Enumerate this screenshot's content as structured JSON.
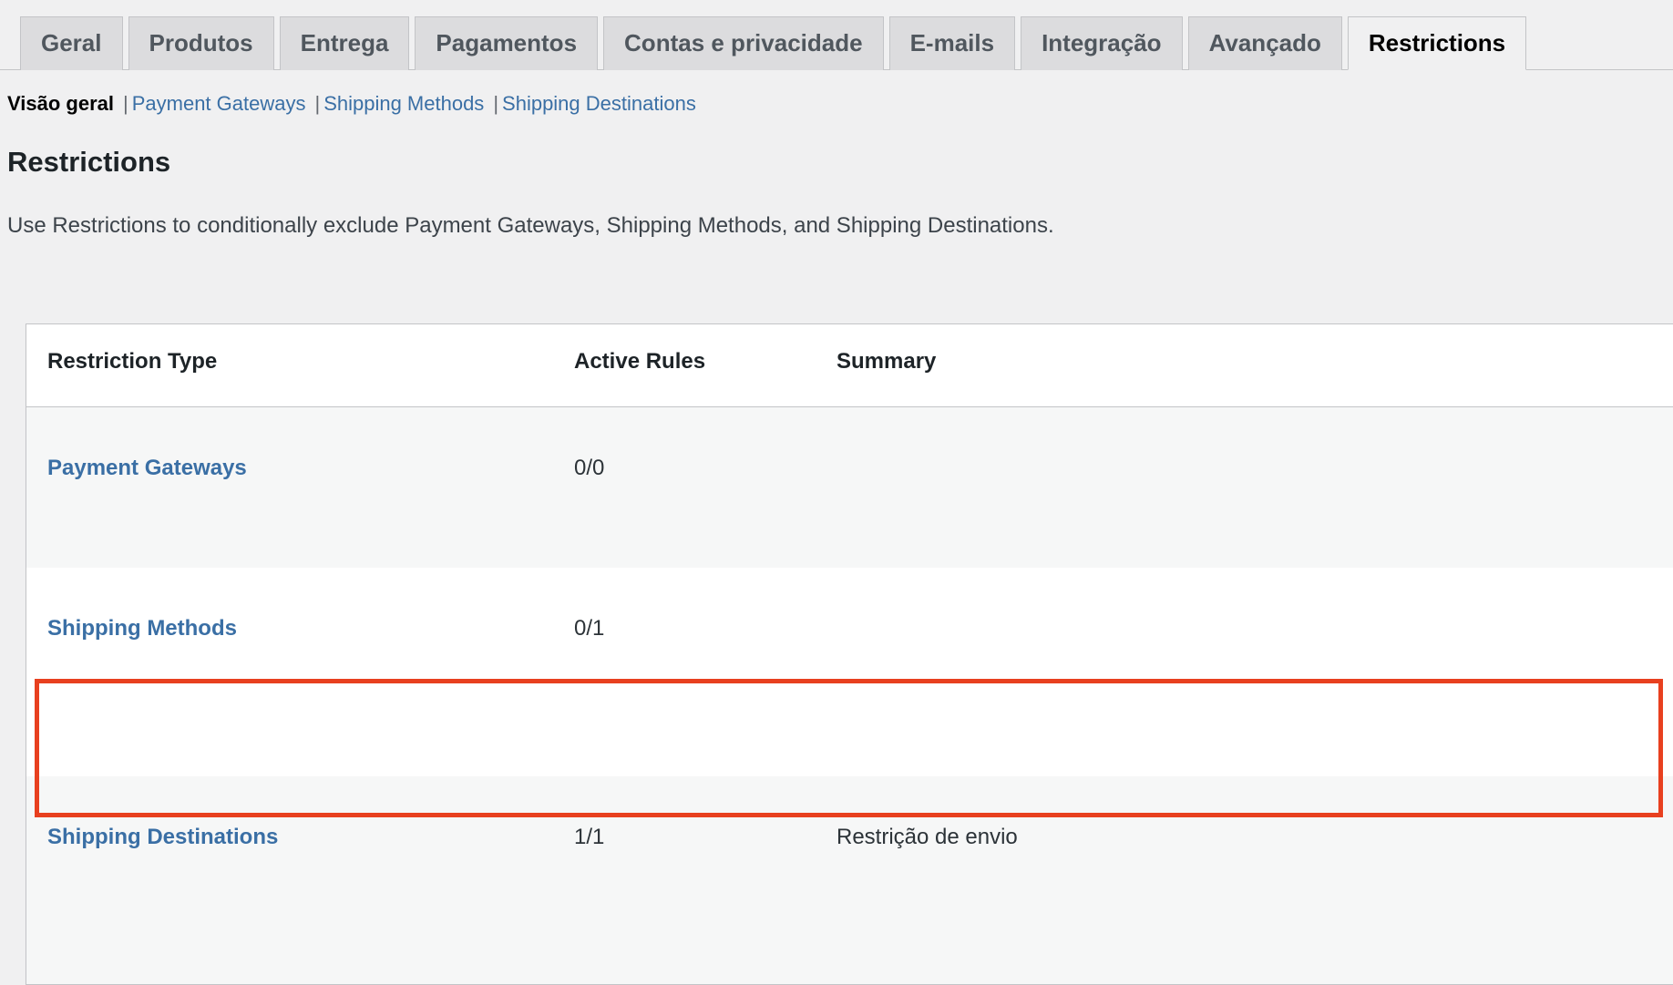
{
  "tabs": [
    {
      "label": "Geral",
      "active": false
    },
    {
      "label": "Produtos",
      "active": false
    },
    {
      "label": "Entrega",
      "active": false
    },
    {
      "label": "Pagamentos",
      "active": false
    },
    {
      "label": "Contas e privacidade",
      "active": false
    },
    {
      "label": "E-mails",
      "active": false
    },
    {
      "label": "Integração",
      "active": false
    },
    {
      "label": "Avançado",
      "active": false
    },
    {
      "label": "Restrictions",
      "active": true
    }
  ],
  "subnav": {
    "current": "Visão geral",
    "separator": "|",
    "links": [
      "Payment Gateways",
      "Shipping Methods",
      "Shipping Destinations"
    ]
  },
  "heading": "Restrictions",
  "description": "Use Restrictions to conditionally exclude Payment Gateways, Shipping Methods, and Shipping Destinations.",
  "table": {
    "columns": [
      "Restriction Type",
      "Active Rules",
      "Summary"
    ],
    "rows": [
      {
        "type": "Payment Gateways",
        "rules": "0/0",
        "summary": ""
      },
      {
        "type": "Shipping Methods",
        "rules": "0/1",
        "summary": ""
      },
      {
        "type": "Shipping Destinations",
        "rules": "1/1",
        "summary": "Restrição de envio"
      }
    ]
  },
  "colors": {
    "link": "#3a6fa5",
    "highlight": "#e8401f",
    "page_background": "#f0f0f1",
    "tab_inactive": "#dcdcde",
    "row_alt": "#f6f7f7"
  }
}
